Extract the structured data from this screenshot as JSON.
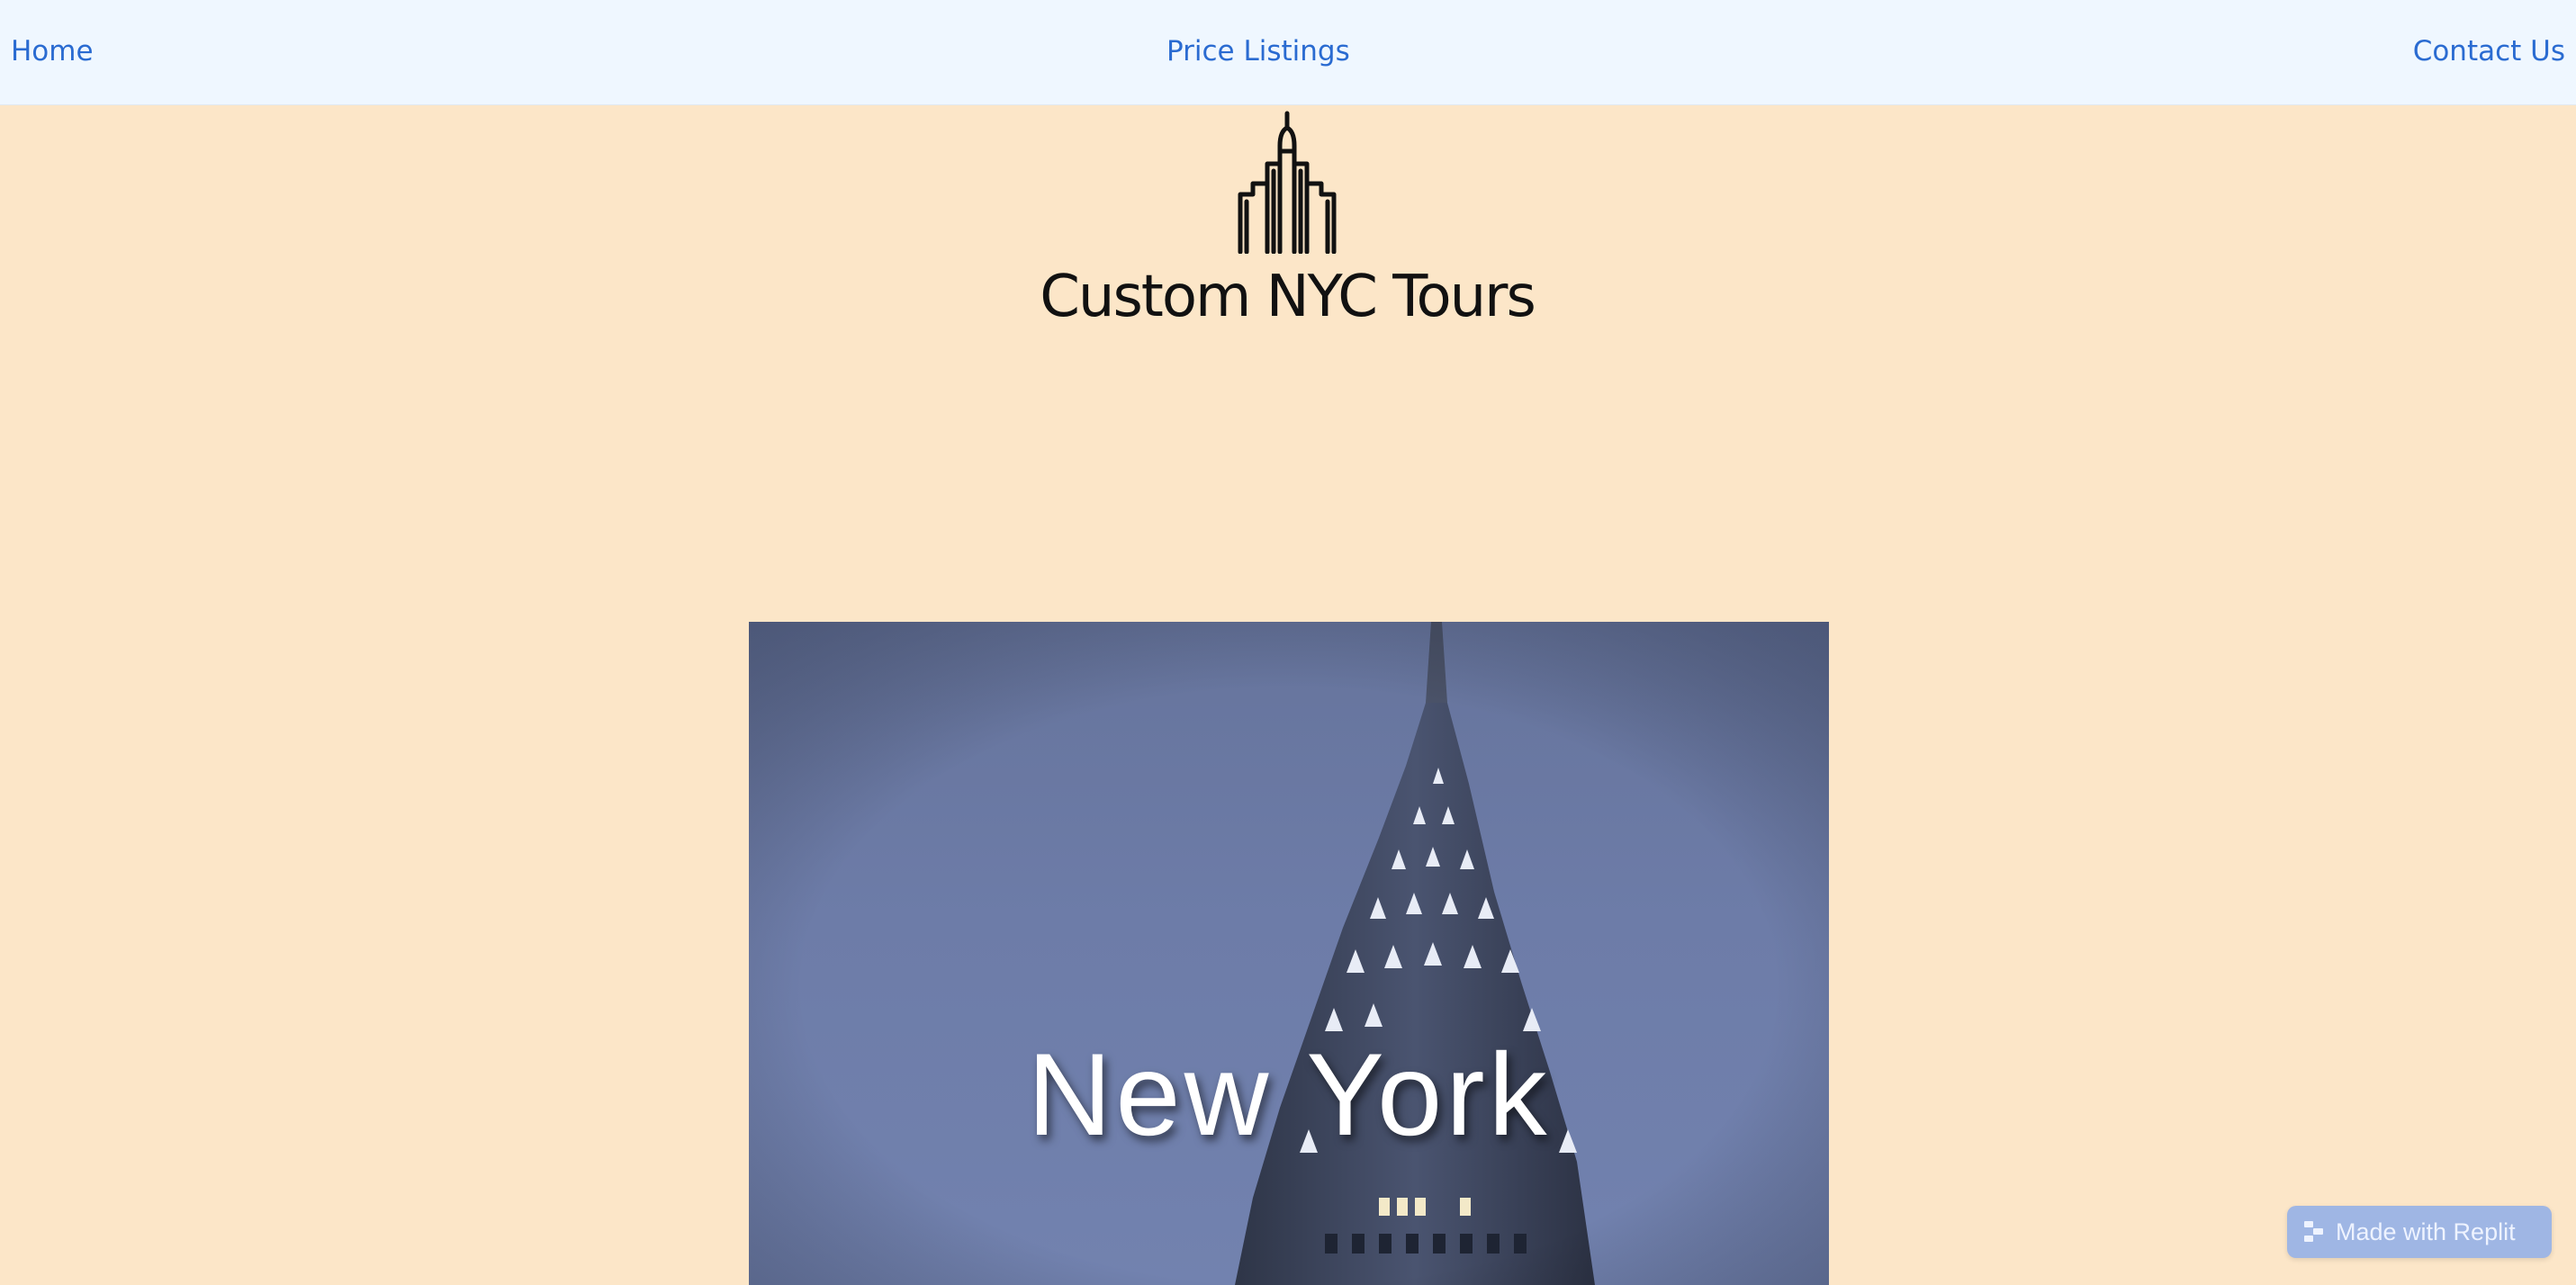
{
  "nav": {
    "home": "Home",
    "prices": "Price Listings",
    "contact": "Contact Us"
  },
  "brand": {
    "title": "Custom NYC Tours",
    "logo_icon": "skyline-icon"
  },
  "hero": {
    "caption": "New York",
    "image_subject": "chrysler-building-spire"
  },
  "badge": {
    "label": "Made with Replit",
    "icon": "replit-icon"
  },
  "colors": {
    "page_background": "#fce6c8",
    "navbar_background": "#eff7ff",
    "link": "#2a6bd1",
    "badge_background": "#9fb6e4"
  }
}
